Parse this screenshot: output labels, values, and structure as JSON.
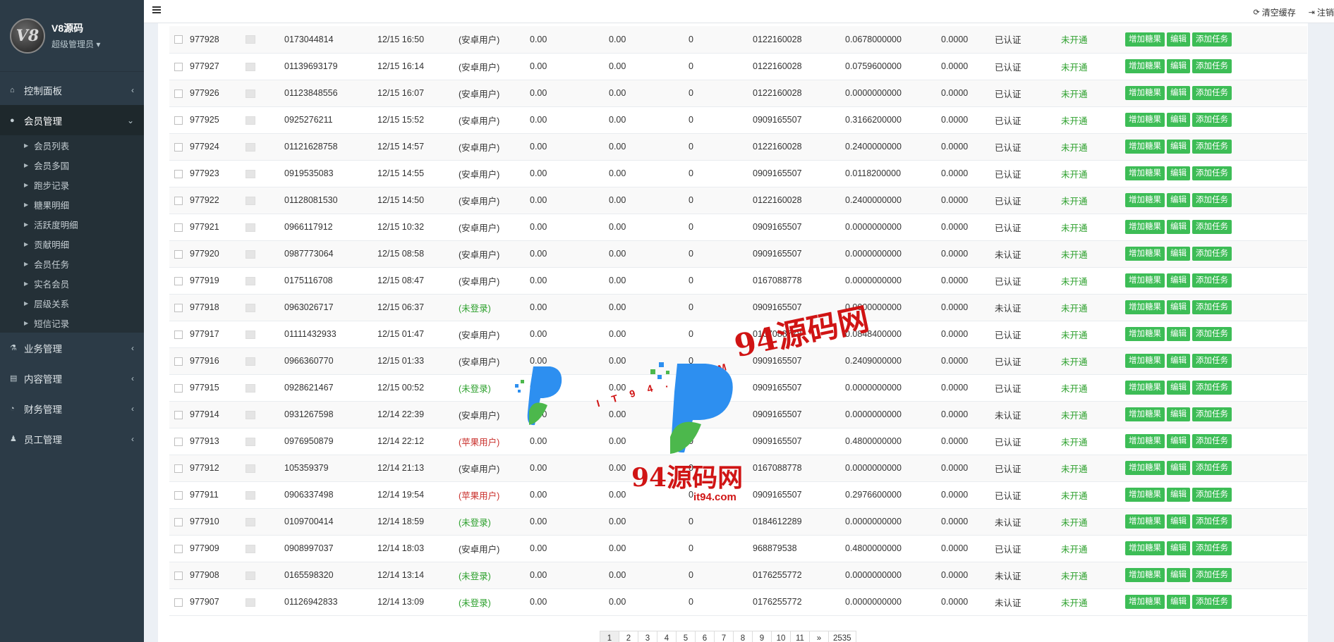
{
  "brand": {
    "logo_text": "V8",
    "title": "V8源码",
    "role": "超级管理员"
  },
  "nav": {
    "dashboard": "控制面板",
    "members": "会员管理",
    "business": "业务管理",
    "content": "内容管理",
    "finance": "财务管理",
    "staff": "员工管理",
    "submenu": [
      "会员列表",
      "会员多国",
      "跑步记录",
      "糖果明细",
      "活跃度明细",
      "贡献明细",
      "会员任务",
      "实名会员",
      "层级关系",
      "短信记录"
    ]
  },
  "topbar": {
    "clear_cache": "清空缓存",
    "logout": "注销"
  },
  "actions": {
    "add_candy": "增加糖果",
    "edit": "编辑",
    "add_task": "添加任务"
  },
  "rows": [
    {
      "id": "977928",
      "phone": "0173044814",
      "time": "12/15 16:50",
      "type": "(安卓用户)",
      "a": "0.00",
      "b": "0.00",
      "c": "0",
      "ref": "0122160028",
      "val": "0.0678000000",
      "val2": "0.0000",
      "auth": "已认证",
      "status": "未开通"
    },
    {
      "id": "977927",
      "phone": "01139693179",
      "time": "12/15 16:14",
      "type": "(安卓用户)",
      "a": "0.00",
      "b": "0.00",
      "c": "0",
      "ref": "0122160028",
      "val": "0.0759600000",
      "val2": "0.0000",
      "auth": "已认证",
      "status": "未开通"
    },
    {
      "id": "977926",
      "phone": "01123848556",
      "time": "12/15 16:07",
      "type": "(安卓用户)",
      "a": "0.00",
      "b": "0.00",
      "c": "0",
      "ref": "0122160028",
      "val": "0.0000000000",
      "val2": "0.0000",
      "auth": "已认证",
      "status": "未开通"
    },
    {
      "id": "977925",
      "phone": "0925276211",
      "time": "12/15 15:52",
      "type": "(安卓用户)",
      "a": "0.00",
      "b": "0.00",
      "c": "0",
      "ref": "0909165507",
      "val": "0.3166200000",
      "val2": "0.0000",
      "auth": "已认证",
      "status": "未开通"
    },
    {
      "id": "977924",
      "phone": "01121628758",
      "time": "12/15 14:57",
      "type": "(安卓用户)",
      "a": "0.00",
      "b": "0.00",
      "c": "0",
      "ref": "0122160028",
      "val": "0.2400000000",
      "val2": "0.0000",
      "auth": "已认证",
      "status": "未开通"
    },
    {
      "id": "977923",
      "phone": "0919535083",
      "time": "12/15 14:55",
      "type": "(安卓用户)",
      "a": "0.00",
      "b": "0.00",
      "c": "0",
      "ref": "0909165507",
      "val": "0.0118200000",
      "val2": "0.0000",
      "auth": "已认证",
      "status": "未开通"
    },
    {
      "id": "977922",
      "phone": "01128081530",
      "time": "12/15 14:50",
      "type": "(安卓用户)",
      "a": "0.00",
      "b": "0.00",
      "c": "0",
      "ref": "0122160028",
      "val": "0.2400000000",
      "val2": "0.0000",
      "auth": "已认证",
      "status": "未开通"
    },
    {
      "id": "977921",
      "phone": "0966117912",
      "time": "12/15 10:32",
      "type": "(安卓用户)",
      "a": "0.00",
      "b": "0.00",
      "c": "0",
      "ref": "0909165507",
      "val": "0.0000000000",
      "val2": "0.0000",
      "auth": "已认证",
      "status": "未开通"
    },
    {
      "id": "977920",
      "phone": "0987773064",
      "time": "12/15 08:58",
      "type": "(安卓用户)",
      "a": "0.00",
      "b": "0.00",
      "c": "0",
      "ref": "0909165507",
      "val": "0.0000000000",
      "val2": "0.0000",
      "auth": "未认证",
      "status": "未开通"
    },
    {
      "id": "977919",
      "phone": "0175116708",
      "time": "12/15 08:47",
      "type": "(安卓用户)",
      "a": "0.00",
      "b": "0.00",
      "c": "0",
      "ref": "0167088778",
      "val": "0.0000000000",
      "val2": "0.0000",
      "auth": "已认证",
      "status": "未开通"
    },
    {
      "id": "977918",
      "phone": "0963026717",
      "time": "12/15 06:37",
      "type": "(未登录)",
      "a": "0.00",
      "b": "0.00",
      "c": "0",
      "ref": "0909165507",
      "val": "0.0000000000",
      "val2": "0.0000",
      "auth": "未认证",
      "status": "未开通"
    },
    {
      "id": "977917",
      "phone": "01111432933",
      "time": "12/15 01:47",
      "type": "(安卓用户)",
      "a": "0.00",
      "b": "0.00",
      "c": "0",
      "ref": "0167088778",
      "val": "0.0848400000",
      "val2": "0.0000",
      "auth": "已认证",
      "status": "未开通"
    },
    {
      "id": "977916",
      "phone": "0966360770",
      "time": "12/15 01:33",
      "type": "(安卓用户)",
      "a": "0.00",
      "b": "0.00",
      "c": "0",
      "ref": "0909165507",
      "val": "0.2409000000",
      "val2": "0.0000",
      "auth": "已认证",
      "status": "未开通"
    },
    {
      "id": "977915",
      "phone": "0928621467",
      "time": "12/15 00:52",
      "type": "(未登录)",
      "a": "0.00",
      "b": "0.00",
      "c": "0",
      "ref": "0909165507",
      "val": "0.0000000000",
      "val2": "0.0000",
      "auth": "已认证",
      "status": "未开通"
    },
    {
      "id": "977914",
      "phone": "0931267598",
      "time": "12/14 22:39",
      "type": "(安卓用户)",
      "a": "0.00",
      "b": "0.00",
      "c": "0",
      "ref": "0909165507",
      "val": "0.0000000000",
      "val2": "0.0000",
      "auth": "未认证",
      "status": "未开通"
    },
    {
      "id": "977913",
      "phone": "0976950879",
      "time": "12/14 22:12",
      "type": "(苹果用户)",
      "a": "0.00",
      "b": "0.00",
      "c": "0",
      "ref": "0909165507",
      "val": "0.4800000000",
      "val2": "0.0000",
      "auth": "已认证",
      "status": "未开通"
    },
    {
      "id": "977912",
      "phone": "105359379",
      "time": "12/14 21:13",
      "type": "(安卓用户)",
      "a": "0.00",
      "b": "0.00",
      "c": "0",
      "ref": "0167088778",
      "val": "0.0000000000",
      "val2": "0.0000",
      "auth": "已认证",
      "status": "未开通"
    },
    {
      "id": "977911",
      "phone": "0906337498",
      "time": "12/14 19:54",
      "type": "(苹果用户)",
      "a": "0.00",
      "b": "0.00",
      "c": "0",
      "ref": "0909165507",
      "val": "0.2976600000",
      "val2": "0.0000",
      "auth": "已认证",
      "status": "未开通"
    },
    {
      "id": "977910",
      "phone": "0109700414",
      "time": "12/14 18:59",
      "type": "(未登录)",
      "a": "0.00",
      "b": "0.00",
      "c": "0",
      "ref": "0184612289",
      "val": "0.0000000000",
      "val2": "0.0000",
      "auth": "未认证",
      "status": "未开通"
    },
    {
      "id": "977909",
      "phone": "0908997037",
      "time": "12/14 18:03",
      "type": "(安卓用户)",
      "a": "0.00",
      "b": "0.00",
      "c": "0",
      "ref": "968879538",
      "val": "0.4800000000",
      "val2": "0.0000",
      "auth": "已认证",
      "status": "未开通"
    },
    {
      "id": "977908",
      "phone": "0165598320",
      "time": "12/14 13:14",
      "type": "(未登录)",
      "a": "0.00",
      "b": "0.00",
      "c": "0",
      "ref": "0176255772",
      "val": "0.0000000000",
      "val2": "0.0000",
      "auth": "未认证",
      "status": "未开通"
    },
    {
      "id": "977907",
      "phone": "01126942833",
      "time": "12/14 13:09",
      "type": "(未登录)",
      "a": "0.00",
      "b": "0.00",
      "c": "0",
      "ref": "0176255772",
      "val": "0.0000000000",
      "val2": "0.0000",
      "auth": "未认证",
      "status": "未开通"
    }
  ],
  "pagination": [
    "1",
    "2",
    "3",
    "4",
    "5",
    "6",
    "7",
    "8",
    "9",
    "10",
    "11",
    "»",
    "2535"
  ],
  "watermark": {
    "line1": "94源码网",
    "sub1": "IT94.COM",
    "line2": "94源码网",
    "sub2": "it94.com"
  }
}
